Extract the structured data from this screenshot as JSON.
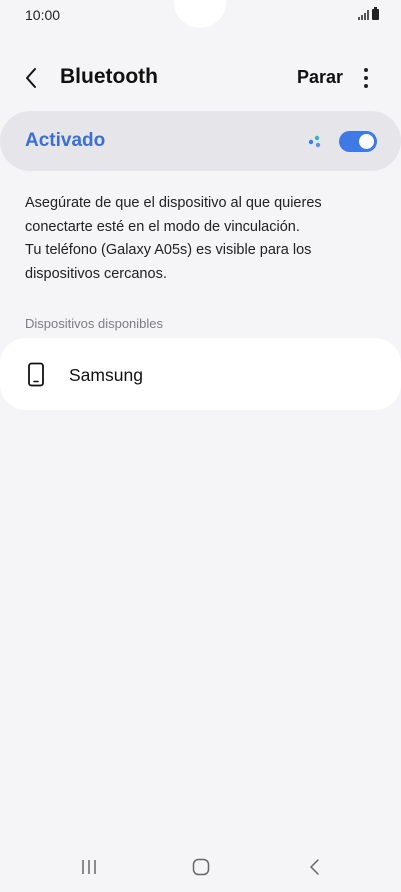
{
  "status_bar": {
    "time": "10:00"
  },
  "header": {
    "title": "Bluetooth",
    "stop_label": "Parar",
    "back_icon": "chevron-left-icon",
    "more_icon": "more-vertical-icon"
  },
  "bluetooth_toggle": {
    "label": "Activado",
    "enabled": true,
    "accent_color": "#3e79e6"
  },
  "description": {
    "line1": "Asegúrate de que el dispositivo al que quieres",
    "line2": "conectarte esté en el modo de vinculación.",
    "line3": "Tu teléfono (Galaxy A05s) es visible para los",
    "line4": "dispositivos cercanos."
  },
  "available_devices": {
    "section_title": "Dispositivos disponibles",
    "items": [
      {
        "name": "Samsung",
        "icon": "phone-icon"
      }
    ]
  },
  "nav_bar": {
    "recents_icon": "recents-icon",
    "home_icon": "home-icon",
    "back_icon": "back-icon"
  }
}
